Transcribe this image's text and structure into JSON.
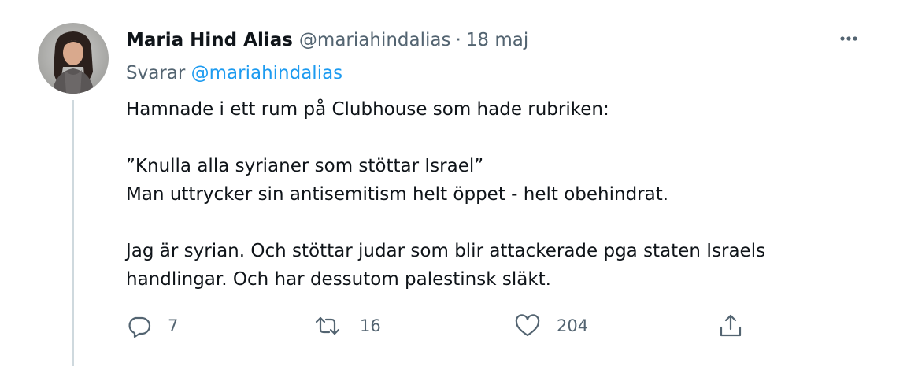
{
  "tweet": {
    "author_name": "Maria Hind Alias",
    "author_handle": "@mariahindalias",
    "separator": "·",
    "date": "18 maj",
    "reply_prefix": "Svarar",
    "reply_to": "@mariahindalias",
    "paragraphs": [
      [
        "Hamnade i ett rum på Clubhouse som hade rubriken:"
      ],
      [
        "”Knulla alla syrianer som stöttar Israel”",
        "Man uttrycker sin antisemitism helt öppet - helt obehindrat."
      ],
      [
        "Jag är syrian. Och stöttar judar som blir attackerade pga staten Israels",
        "handlingar. Och har dessutom palestinsk släkt."
      ]
    ],
    "actions": {
      "reply_count": "7",
      "retweet_count": "16",
      "like_count": "204"
    }
  },
  "icons": {
    "avatar": "avatar-photo",
    "more": "more-horizontal-icon",
    "reply": "reply-bubble-icon",
    "retweet": "retweet-icon",
    "like": "heart-icon",
    "share": "share-icon"
  },
  "colors": {
    "text": "#0f1419",
    "secondary": "#536471",
    "link": "#1d9bf0",
    "thread_line": "#cfd9de"
  }
}
